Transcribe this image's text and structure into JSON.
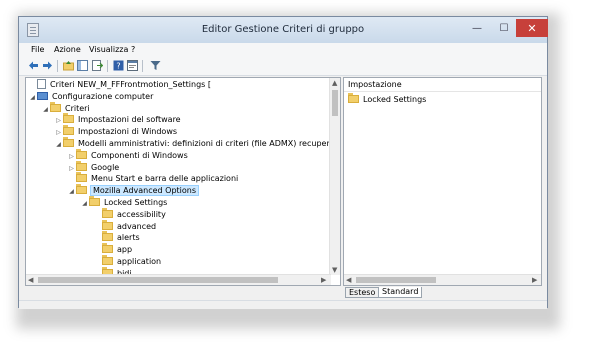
{
  "window": {
    "title": "Editor Gestione Criteri di gruppo",
    "minimize_glyph": "—",
    "maximize_glyph": "☐",
    "close_glyph": "✕"
  },
  "menu": {
    "items": [
      "File",
      "Azione",
      "Visualizza",
      "?"
    ]
  },
  "toolbar": {
    "icons": [
      "back-arrow-icon",
      "forward-arrow-icon",
      "up-folder-icon",
      "show-hide-tree-icon",
      "export-list-icon",
      "help-icon",
      "properties-icon",
      "filter-icon"
    ]
  },
  "tree": {
    "items": [
      {
        "label": "Criteri NEW_M_FFFrontmotion_Settings [",
        "level": 0,
        "expander": "",
        "icon": "policy-icon",
        "selected": false
      },
      {
        "label": "Configurazione computer",
        "level": 0,
        "expander": "◢",
        "icon": "computer-icon",
        "selected": false
      },
      {
        "label": "Criteri",
        "level": 1,
        "expander": "◢",
        "icon": "folder-icon",
        "selected": false
      },
      {
        "label": "Impostazioni del software",
        "level": 2,
        "expander": "▷",
        "icon": "folder-icon",
        "selected": false
      },
      {
        "label": "Impostazioni di Windows",
        "level": 2,
        "expander": "▷",
        "icon": "folder-icon",
        "selected": false
      },
      {
        "label": "Modelli amministrativi: definizioni di criteri (file ADMX) recuperate dal c",
        "level": 2,
        "expander": "◢",
        "icon": "folder-icon",
        "selected": false
      },
      {
        "label": "Componenti di Windows",
        "level": 3,
        "expander": "▷",
        "icon": "folder-icon",
        "selected": false
      },
      {
        "label": "Google",
        "level": 3,
        "expander": "▷",
        "icon": "folder-icon",
        "selected": false
      },
      {
        "label": "Menu Start e barra delle applicazioni",
        "level": 3,
        "expander": "",
        "icon": "folder-icon",
        "selected": false
      },
      {
        "label": "Mozilla Advanced Options",
        "level": 3,
        "expander": "◢",
        "icon": "folder-icon",
        "selected": true
      },
      {
        "label": "Locked Settings",
        "level": 4,
        "expander": "◢",
        "icon": "folder-icon",
        "selected": false
      },
      {
        "label": "accessibility",
        "level": 5,
        "expander": "",
        "icon": "folder-icon",
        "selected": false
      },
      {
        "label": "advanced",
        "level": 5,
        "expander": "",
        "icon": "folder-icon",
        "selected": false
      },
      {
        "label": "alerts",
        "level": 5,
        "expander": "",
        "icon": "folder-icon",
        "selected": false
      },
      {
        "label": "app",
        "level": 5,
        "expander": "",
        "icon": "folder-icon",
        "selected": false
      },
      {
        "label": "application",
        "level": 5,
        "expander": "",
        "icon": "folder-icon",
        "selected": false
      },
      {
        "label": "bidi",
        "level": 5,
        "expander": "",
        "icon": "folder-icon",
        "selected": false
      }
    ]
  },
  "details": {
    "column_header": "Impostazione",
    "items": [
      "Locked Settings"
    ]
  },
  "tabs": [
    "Esteso",
    "Standard"
  ],
  "colors": {
    "close_button": "#c7403a",
    "selection": "#cce8ff",
    "folder": "#f2cf6b"
  }
}
